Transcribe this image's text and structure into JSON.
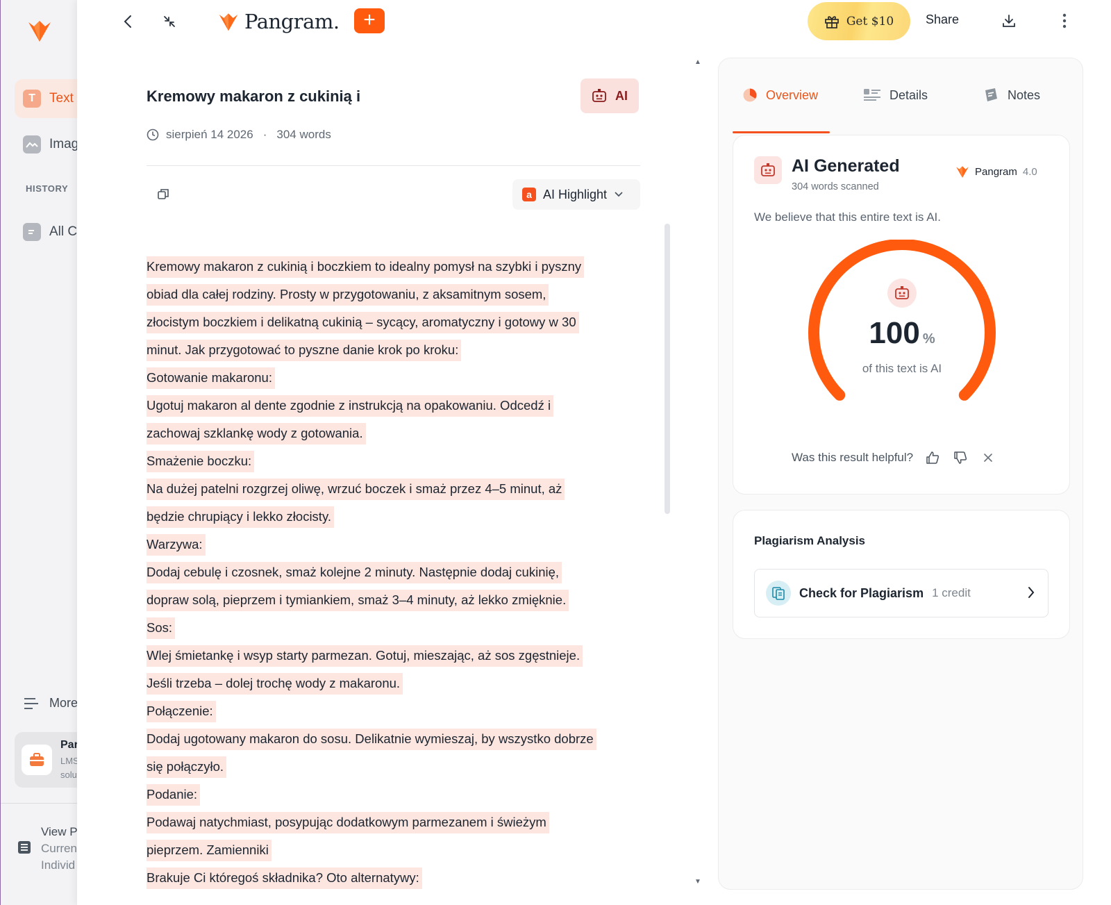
{
  "sidebar": {
    "items": [
      {
        "label": "Text",
        "icon": "text-icon",
        "active": true
      },
      {
        "label": "Imag",
        "icon": "image-icon",
        "active": false
      }
    ],
    "history_label": "HISTORY",
    "history_item": "All Cl",
    "more_label": "More",
    "promo": {
      "title": "Par",
      "line1": "LMS",
      "line2": "solu"
    },
    "plan": {
      "line1": "View P",
      "line2": "Curren",
      "line3": "Individ"
    }
  },
  "topbar": {
    "brand": "Pangram.",
    "plus": "+",
    "gift_label": "Get $10",
    "share_label": "Share"
  },
  "document": {
    "title": "Kremowy makaron z cukinią i",
    "badge": "AI",
    "date": "sierpień 14 2026",
    "separator": "·",
    "words": "304 words",
    "highlight_label": "AI Highlight",
    "highlight_icon_letter": "a",
    "lines": [
      "Kremowy makaron z cukinią i boczkiem to idealny pomysł na szybki i pyszny",
      "obiad dla całej rodziny. Prosty w przygotowaniu, z aksamitnym sosem,",
      "złocistym boczkiem i delikatną cukinią – sycący, aromatyczny i gotowy w 30",
      "minut. Jak przygotować to pyszne danie krok po kroku:",
      "Gotowanie makaronu:",
      "Ugotuj makaron al dente zgodnie z instrukcją na opakowaniu. Odcedź i",
      "zachowaj szklankę wody z gotowania.",
      "Smażenie boczku:",
      "Na dużej patelni rozgrzej oliwę, wrzuć boczek i smaż przez 4–5 minut, aż",
      "będzie chrupiący i lekko złocisty.",
      "Warzywa:",
      "Dodaj cebulę i czosnek, smaż kolejne 2 minuty. Następnie dodaj cukinię,",
      "dopraw solą, pieprzem i tymiankiem, smaż 3–4 minuty, aż lekko zmięknie.",
      "Sos:",
      "Wlej śmietankę i wsyp starty parmezan. Gotuj, mieszając, aż sos zgęstnieje.",
      "Jeśli trzeba – dolej trochę wody z makaronu.",
      "Połączenie:",
      "Dodaj ugotowany makaron do sosu. Delikatnie wymieszaj, by wszystko dobrze",
      "się połączyło.",
      "Podanie:",
      "Podawaj natychmiast, posypując dodatkowym parmezanem i świeżym",
      "pieprzem. Zamienniki",
      "Brakuje Ci któregoś składnika? Oto alternatywy:"
    ]
  },
  "panel": {
    "tabs": [
      {
        "label": "Overview",
        "icon": "overview-icon",
        "active": true
      },
      {
        "label": "Details",
        "icon": "details-icon",
        "active": false
      },
      {
        "label": "Notes",
        "icon": "notes-icon",
        "active": false
      }
    ],
    "result": {
      "title": "AI Generated",
      "scanned": "304 words scanned",
      "model_name": "Pangram",
      "model_version": "4.0",
      "description": "We believe that this entire text is AI.",
      "percent_value": "100",
      "percent_fraction": 1.0,
      "percent_sign": "%",
      "percent_label": "of this text is AI",
      "helpful_question": "Was this result helpful?"
    },
    "plagiarism": {
      "title": "Plagiarism Analysis",
      "button_label": "Check for Plagiarism",
      "credit": "1 credit"
    }
  },
  "colors": {
    "accent": "#ff5a0d",
    "highlight": "#fde6e0",
    "gauge": "#ff5a0d"
  }
}
